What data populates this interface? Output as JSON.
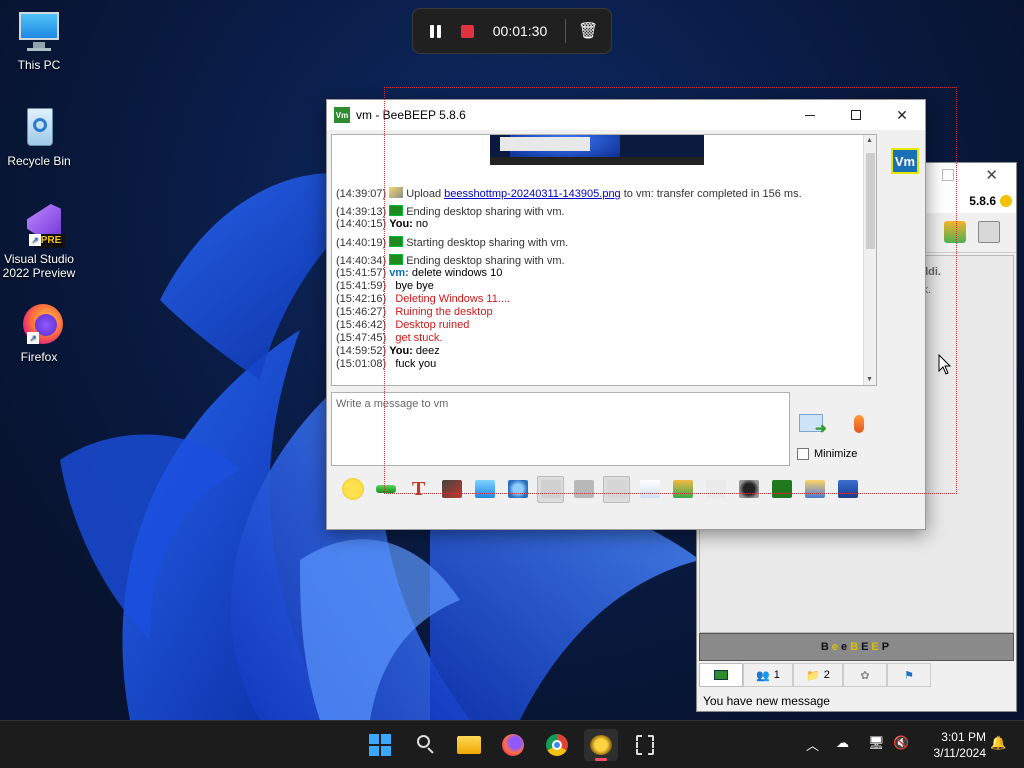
{
  "desktop": {
    "icons": [
      {
        "label": "This PC"
      },
      {
        "label": "Recycle Bin"
      },
      {
        "label": "Visual Studio 2022 Preview",
        "badge": "PRE"
      },
      {
        "label": "Firefox"
      }
    ]
  },
  "recorder": {
    "time": "00:01:30",
    "icons": [
      "pause-icon",
      "stop-icon",
      "trash-icon"
    ]
  },
  "chat_window": {
    "title": "vm - BeeBEEP 5.8.6",
    "app_badge": "Vm",
    "avatar": "Vm",
    "input_placeholder": "Write a message to vm",
    "minimize_label": "Minimize",
    "messages": [
      {
        "time": "(14:39:07)",
        "prefix": "Upload ",
        "link": "beesshottmp-20240311-143905.png",
        "text": " to vm: transfer completed in 156 ms."
      },
      {
        "time": "(14:39:13)",
        "text": "Ending desktop sharing with vm."
      },
      {
        "time": "(14:40:15)",
        "user": "You:",
        "text": "no"
      },
      {
        "time": "(14:40:19)",
        "text": "Starting desktop sharing with vm."
      },
      {
        "time": "(14:40:34)",
        "text": "Ending desktop sharing with vm."
      },
      {
        "time": "(15:41:57)",
        "user": "vm:",
        "text": "delete windows 10"
      },
      {
        "time": "(15:41:59)",
        "text": "bye bye"
      },
      {
        "time": "(15:42:16)",
        "text": "Deleting Windows 11....",
        "color": "#d01818"
      },
      {
        "time": "(15:46:27)",
        "text": "Ruining the desktop",
        "color": "#d01818"
      },
      {
        "time": "(15:46:42)",
        "text": "Desktop ruined",
        "color": "#d01818"
      },
      {
        "time": "(15:47:45)",
        "text": "get stuck.",
        "color": "#d01818"
      },
      {
        "time": "(14:59:52)",
        "user": "You:",
        "text": "deez"
      },
      {
        "time": "(15:01:08)",
        "text": "fuck you"
      }
    ],
    "toolbar_icons": [
      "emoji-icon",
      "green-arrow-icon",
      "font-icon",
      "color-pen-icon",
      "filter-icon",
      "settings-icon",
      "spellcheck-icon",
      "text-style-icon",
      "music-note-icon",
      "file-icon",
      "send-file-icon",
      "code-icon",
      "screenshot-icon",
      "desktop-share-icon",
      "save-chat-icon",
      "floppy-icon"
    ]
  },
  "back_window": {
    "version": "5.8.6",
    "text1": "ddi.",
    "text2": "k.",
    "banner": [
      "B",
      "e",
      "e",
      "B",
      "E",
      "E",
      "P"
    ],
    "banner_colors": [
      "#111111",
      "#d6c200",
      "#111111",
      "#d6c200",
      "#111111",
      "#d6c200",
      "#111111"
    ],
    "tabs": [
      "",
      "1",
      "2",
      "",
      ""
    ],
    "status": "You have new message"
  },
  "taskbar": {
    "clock_time": "3:01 PM",
    "clock_date": "3/11/2024",
    "apps": [
      "windows-start-icon",
      "search-icon",
      "file-explorer-icon",
      "firefox-icon",
      "chrome-icon",
      "beebeep-icon",
      "snipping-tool-icon"
    ]
  }
}
